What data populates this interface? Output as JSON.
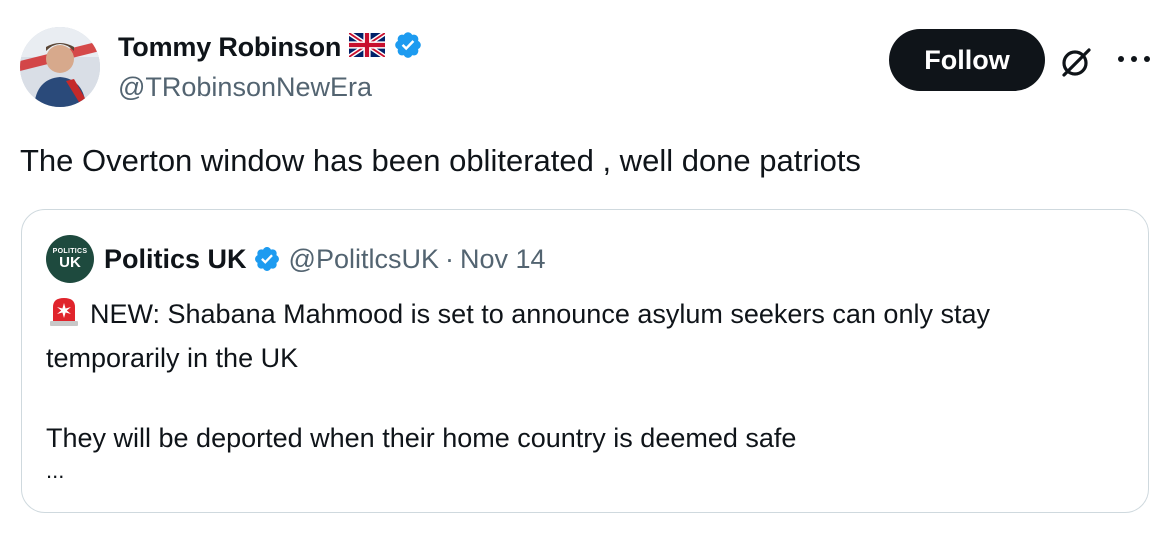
{
  "author": {
    "name": "Tommy Robinson",
    "handle": "@TRobinsonNewEra",
    "flag_icon": "uk-flag-icon",
    "verified_icon": "verified-badge-icon"
  },
  "actions": {
    "follow_label": "Follow",
    "grok_icon": "grok-icon",
    "more_icon": "more-options-icon"
  },
  "tweet": {
    "text": "The Overton window has been obliterated , well done patriots"
  },
  "quoted": {
    "avatar_top": "POLITICS",
    "avatar_bottom": "UK",
    "name": "Politics UK",
    "handle": "@PolitlcsUK",
    "separator": "·",
    "date": "Nov 14",
    "line1": "NEW: Shabana Mahmood is set to announce asylum seekers can only stay",
    "line2": "temporarily in the UK",
    "line3": "They will be deported when their home country is deemed safe",
    "ellipsis": "...",
    "siren_icon": "siren-icon"
  },
  "colors": {
    "text": "#0f1419",
    "secondary": "#536471",
    "verified": "#1d9bf0",
    "border": "#cfd9de",
    "follow_bg": "#0f1419"
  }
}
